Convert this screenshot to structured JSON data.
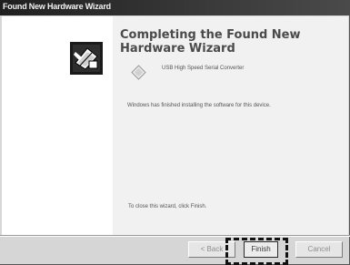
{
  "window": {
    "title": "Found New Hardware Wizard"
  },
  "wizard": {
    "heading": "Completing the Found New Hardware Wizard",
    "device_name": "USB High Speed Serial Converter",
    "message": "Windows has finished installing the software for this device.",
    "close_instruction": "To close this wizard, click Finish."
  },
  "buttons": {
    "back": "< Back",
    "finish": "Finish",
    "cancel": "Cancel"
  },
  "icons": {
    "wizard": "hardware-wizard-icon",
    "device": "device-icon"
  }
}
